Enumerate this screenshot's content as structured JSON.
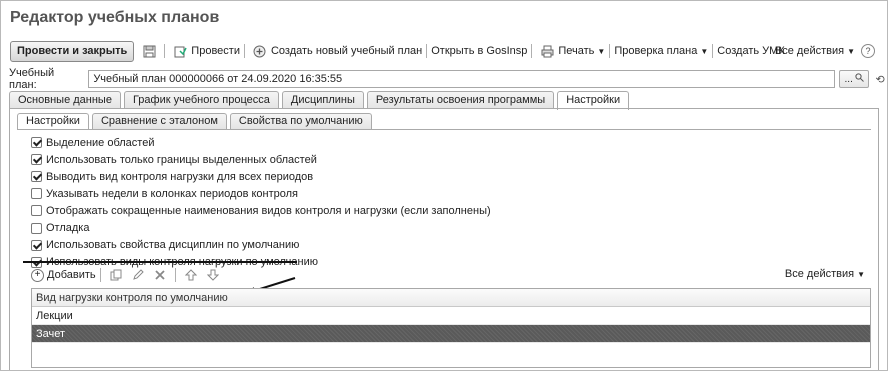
{
  "window": {
    "title": "Редактор учебных планов"
  },
  "toolbar": {
    "primary_button": "Провести и закрыть",
    "post_label": "Провести",
    "create_plan_label": "Создать новый учебный план",
    "open_gosinsp_label": "Открыть в GosInsp",
    "print_label": "Печать",
    "check_plan_label": "Проверка плана",
    "create_umk_label": "Создать УМК",
    "all_actions_label": "Все действия"
  },
  "plan": {
    "label": "Учебный план:",
    "value": "Учебный план 000000066 от 24.09.2020 16:35:55",
    "select_button": "...",
    "search_icon": "search-icon"
  },
  "tabs": [
    {
      "label": "Основные данные"
    },
    {
      "label": "График учебного процесса"
    },
    {
      "label": "Дисциплины"
    },
    {
      "label": "Результаты освоения программы"
    },
    {
      "label": "Настройки",
      "active": true
    }
  ],
  "subtabs": [
    {
      "label": "Настройки",
      "active": true
    },
    {
      "label": "Сравнение с эталоном"
    },
    {
      "label": "Свойства по умолчанию"
    }
  ],
  "settings": [
    {
      "label": "Выделение областей",
      "checked": true
    },
    {
      "label": "Использовать только границы выделенных областей",
      "checked": true
    },
    {
      "label": "Выводить вид контроля нагрузки для всех периодов",
      "checked": true
    },
    {
      "label": "Указывать недели в колонках периодов контроля",
      "checked": false
    },
    {
      "label": "Отображать сокращенные наименования видов контроля и нагрузки (если заполнены)",
      "checked": false
    },
    {
      "label": "Отладка",
      "checked": false
    },
    {
      "label": "Использовать свойства дисциплин по умолчанию",
      "checked": true
    },
    {
      "label": "Использовать виды контроля нагрузки по умолчанию",
      "checked": true
    }
  ],
  "grid_toolbar": {
    "add_label": "Добавить",
    "all_actions_label": "Все действия"
  },
  "grid": {
    "header": "Вид нагрузки контроля по умолчанию",
    "rows": [
      {
        "label": "Лекции",
        "selected": false
      },
      {
        "label": "Зачет",
        "selected": true
      }
    ]
  },
  "colors": {
    "selected_row": "#5e5e5e",
    "border": "#aaaaaa"
  }
}
